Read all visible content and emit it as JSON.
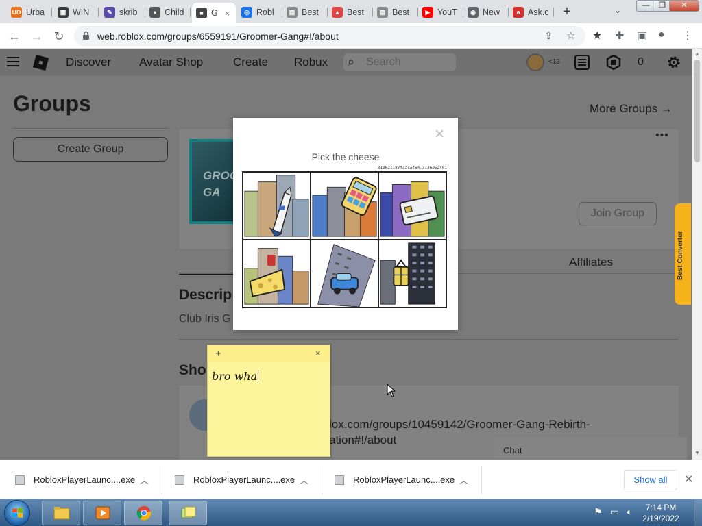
{
  "browser": {
    "tabs": [
      {
        "label": "Urba",
        "icon_text": "UD",
        "color": "#e8711c"
      },
      {
        "label": "WIN",
        "icon_text": "▦",
        "color": "#3a3a3a"
      },
      {
        "label": "skrib",
        "icon_text": "✎",
        "color": "#5b4aa8"
      },
      {
        "label": "Child",
        "icon_text": "●",
        "color": "#555555"
      },
      {
        "label": "G",
        "icon_text": "■",
        "color": "#444444"
      },
      {
        "label": "Robl",
        "icon_text": "◎",
        "color": "#1a73e8"
      },
      {
        "label": "Best",
        "icon_text": "▤",
        "color": "#888888"
      },
      {
        "label": "Best",
        "icon_text": "▲",
        "color": "#e04545"
      },
      {
        "label": "Best",
        "icon_text": "▤",
        "color": "#888888"
      },
      {
        "label": "YouT",
        "icon_text": "▶",
        "color": "#ff0000"
      },
      {
        "label": "New",
        "icon_text": "◉",
        "color": "#5f6368"
      },
      {
        "label": "Ask.c",
        "icon_text": "a",
        "color": "#d32f2f"
      }
    ],
    "new_tab": "+",
    "tab_menu": "⌄",
    "url": "web.roblox.com/groups/6559191/Groomer-Gang#!/about",
    "window_controls": {
      "minimize": "—",
      "restore": "❐",
      "close": "✕"
    }
  },
  "roblox_header": {
    "nav": [
      "Discover",
      "Avatar Shop",
      "Create",
      "Robux"
    ],
    "search_placeholder": "Search",
    "age_badge": "<13",
    "robux_count": "0"
  },
  "page": {
    "title": "Groups",
    "more_groups": "More Groups →",
    "create_group": "Create Group",
    "group_image_text": "GROO\nGA",
    "more_menu": "•••",
    "join_group": "Join Group",
    "affiliates_tab": "Affiliates",
    "description_heading": "Descrip",
    "description_text": "Club Iris G",
    "shout_heading": "Sho",
    "shout_line1": "lox.com/groups/10459142/Groomer-Gang-Rebirth-",
    "shout_line2": "ation#!/about",
    "chat_label": "Chat",
    "side_extension": "Best Converter"
  },
  "captcha": {
    "question": "Pick the cheese",
    "challenge_id": "319621187f3acaf64.3136952401",
    "close": "×",
    "cells": [
      "rocket-shuttle",
      "calculator",
      "credit-card",
      "cheese",
      "car",
      "lantern"
    ]
  },
  "sticky_note": {
    "add": "+",
    "close": "×",
    "text": "bro wha"
  },
  "downloads": {
    "items": [
      {
        "name": "RobloxPlayerLaunc....exe"
      },
      {
        "name": "RobloxPlayerLaunc....exe"
      },
      {
        "name": "RobloxPlayerLaunc....exe"
      }
    ],
    "show_all": "Show all",
    "close": "✕"
  },
  "taskbar": {
    "time": "7:14 PM",
    "date": "2/19/2022"
  }
}
